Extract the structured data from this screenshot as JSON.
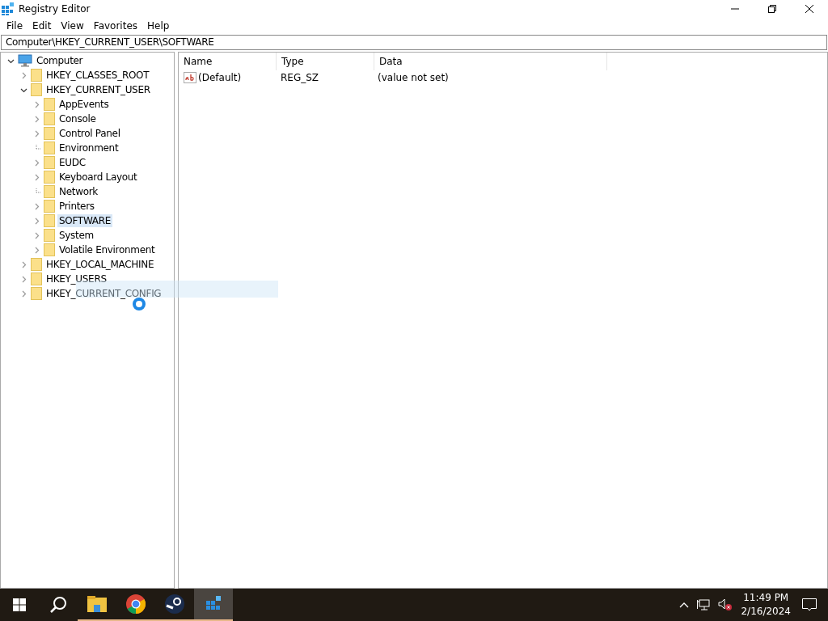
{
  "window": {
    "title": "Registry Editor"
  },
  "menu": [
    "File",
    "Edit",
    "View",
    "Favorites",
    "Help"
  ],
  "address": "Computer\\HKEY_CURRENT_USER\\SOFTWARE",
  "tree": [
    {
      "name": "Computer",
      "kind": "computer",
      "expandable": true,
      "expanded": true,
      "selected": false,
      "children": [
        {
          "name": "HKEY_CLASSES_ROOT",
          "expandable": true,
          "expanded": false,
          "selected": false
        },
        {
          "name": "HKEY_CURRENT_USER",
          "expandable": true,
          "expanded": true,
          "selected": false,
          "children": [
            {
              "name": "AppEvents",
              "expandable": true,
              "expanded": false,
              "selected": false
            },
            {
              "name": "Console",
              "expandable": true,
              "expanded": false,
              "selected": false
            },
            {
              "name": "Control Panel",
              "expandable": true,
              "expanded": false,
              "selected": false
            },
            {
              "name": "Environment",
              "expandable": false,
              "expanded": false,
              "selected": false
            },
            {
              "name": "EUDC",
              "expandable": true,
              "expanded": false,
              "selected": false
            },
            {
              "name": "Keyboard Layout",
              "expandable": true,
              "expanded": false,
              "selected": false
            },
            {
              "name": "Network",
              "expandable": false,
              "expanded": false,
              "selected": false
            },
            {
              "name": "Printers",
              "expandable": true,
              "expanded": false,
              "selected": false
            },
            {
              "name": "SOFTWARE",
              "expandable": true,
              "expanded": false,
              "selected": true
            },
            {
              "name": "System",
              "expandable": true,
              "expanded": false,
              "selected": false
            },
            {
              "name": "Volatile Environment",
              "expandable": true,
              "expanded": false,
              "selected": false
            }
          ]
        },
        {
          "name": "HKEY_LOCAL_MACHINE",
          "expandable": true,
          "expanded": false,
          "selected": false
        },
        {
          "name": "HKEY_USERS",
          "expandable": true,
          "expanded": false,
          "selected": false
        },
        {
          "name": "HKEY_CURRENT_CONFIG",
          "expandable": true,
          "expanded": false,
          "selected": false
        }
      ]
    }
  ],
  "values": {
    "columns": [
      "Name",
      "Type",
      "Data"
    ],
    "rows": [
      {
        "name": "(Default)",
        "type": "REG_SZ",
        "data": "(value not set)"
      }
    ]
  },
  "taskbar": {
    "apps": [
      {
        "kind": "files",
        "active": false,
        "open": true
      },
      {
        "kind": "chrome",
        "active": false,
        "open": true
      },
      {
        "kind": "steam",
        "active": false,
        "open": true
      },
      {
        "kind": "regedit",
        "active": true,
        "open": true
      }
    ],
    "time": "11:49 PM",
    "date": "2/16/2024"
  }
}
